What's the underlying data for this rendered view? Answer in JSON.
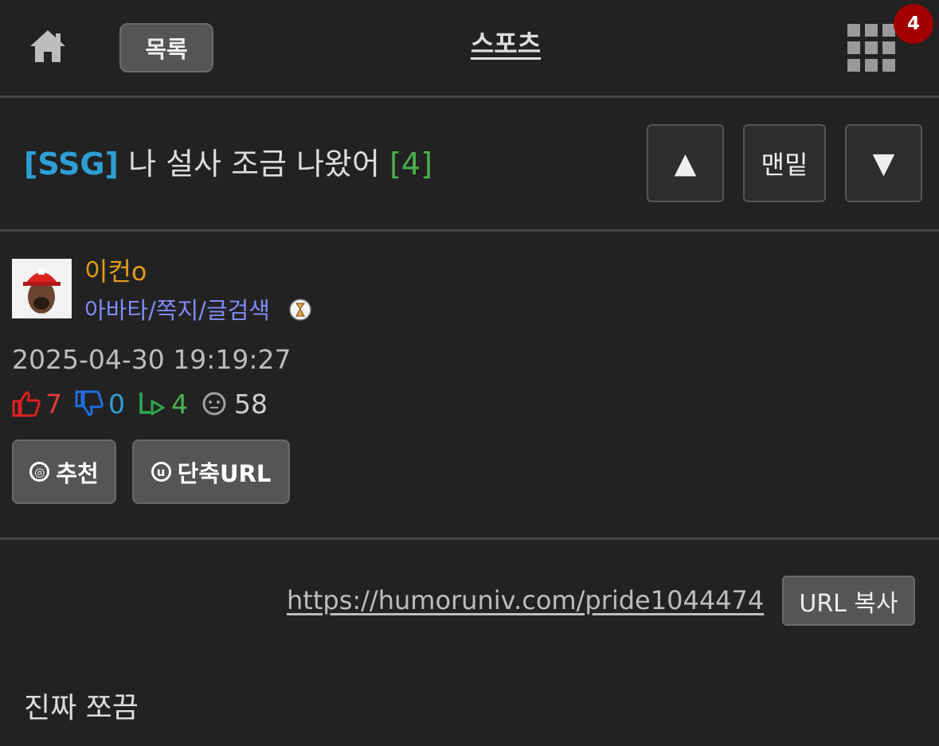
{
  "header": {
    "list_label": "목록",
    "title": "스포츠",
    "notification_count": "4"
  },
  "post": {
    "category": "[SSG]",
    "title": "나 설사 조금 나왔어",
    "comment_count": "[4]",
    "nav": {
      "up": "▲",
      "bottom": "맨밑",
      "down": "▼"
    },
    "author": {
      "nickname": "이컨o",
      "links": "아바타/쪽지/글검색"
    },
    "date": "2025-04-30 19:19:27",
    "stats": {
      "up": "7",
      "down": "0",
      "replies": "4",
      "views": "58"
    },
    "actions": {
      "recommend": "추천",
      "short_url": "단축URL",
      "recommend_icon": "◎",
      "short_url_icon": "u"
    },
    "url": "https://humoruniv.com/pride1044474",
    "copy_label": "URL 복사",
    "body": "진짜 쪼끔"
  },
  "colors": {
    "background": "#222222",
    "category": "#2e9fd6",
    "comment_count": "#4caf50",
    "nickname": "#e39b1c",
    "links": "#7f8bf4",
    "badge": "#a30000"
  }
}
